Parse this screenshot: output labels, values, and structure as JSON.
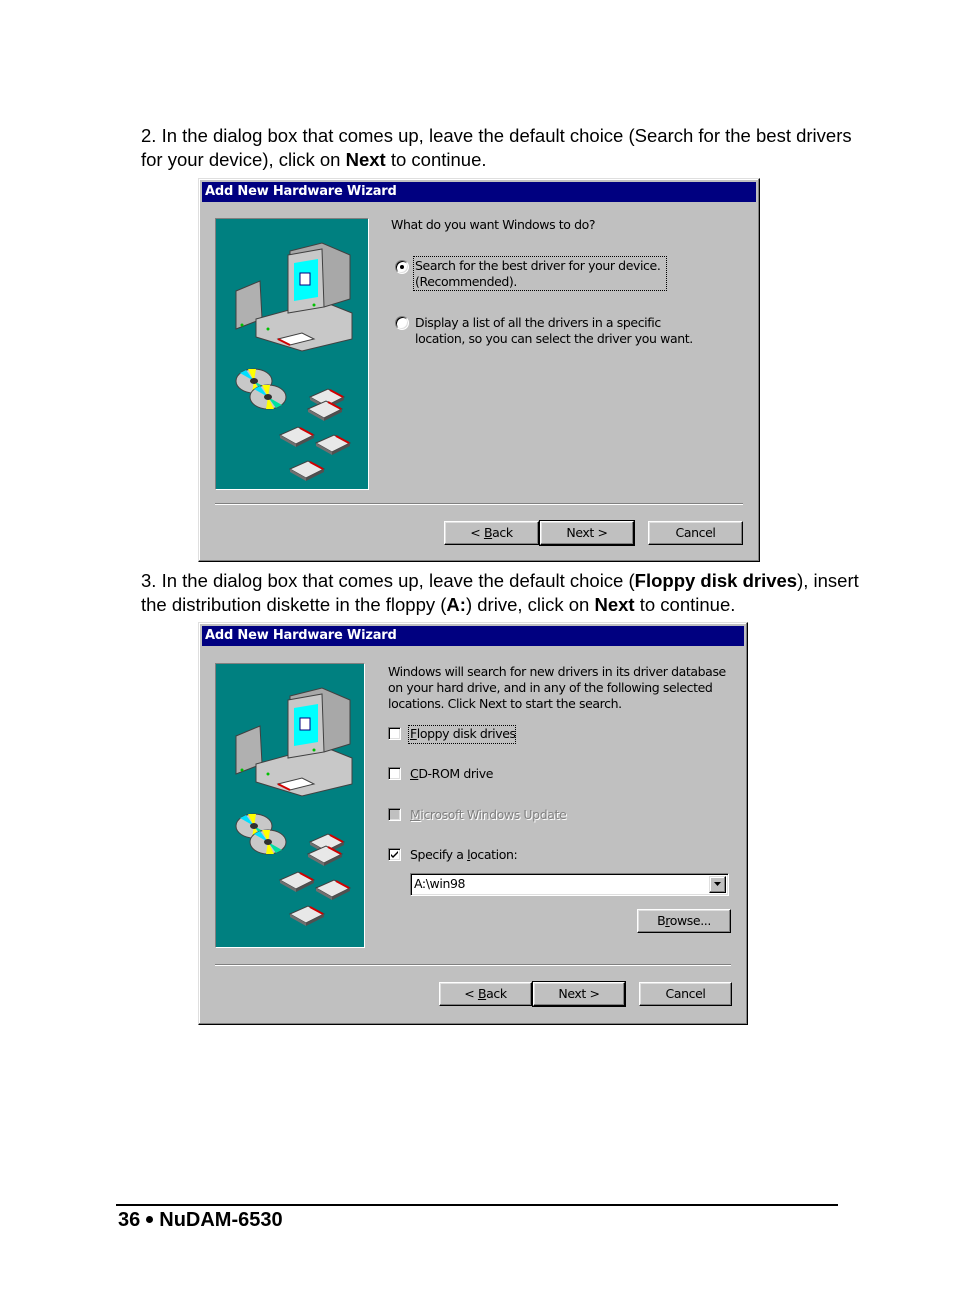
{
  "step2": {
    "text_before": "2. In the dialog box that comes up, leave the default choice (Search for the best drivers for your device), click on ",
    "bold": "Next",
    "text_after": " to continue."
  },
  "dialog1": {
    "title": "Add New Hardware Wizard",
    "prompt": "What do you want Windows to do?",
    "options": [
      {
        "line1": "Search for the best driver for your device.",
        "line2": "(Recommended).",
        "selected": true
      },
      {
        "line1": "Display a list of all the drivers in a specific",
        "line2": "location, so you can select the driver you want.",
        "selected": false
      }
    ],
    "buttons": {
      "back": "< Back",
      "back_mnemonic": "B",
      "next": "Next >",
      "cancel": "Cancel"
    }
  },
  "step3": {
    "t1": "3. In the dialog box that comes up, leave the default choice (",
    "b1": "Floppy disk drives",
    "t2": "), insert the distribution diskette in the floppy (",
    "b2": "A:",
    "t3": ") drive, click on ",
    "b3": "Next",
    "t4": " to continue."
  },
  "dialog2": {
    "title": "Add New Hardware Wizard",
    "description": [
      "Windows will search for new drivers in its driver database",
      "on your hard drive, and in any of the following selected",
      "locations. Click Next to start the search."
    ],
    "checkboxes": [
      {
        "label": "Floppy disk drives",
        "checked": false,
        "enabled": true
      },
      {
        "label": "CD-ROM drive",
        "checked": false,
        "enabled": true
      },
      {
        "label": "Microsoft Windows Update",
        "checked": false,
        "enabled": false
      },
      {
        "label": "Specify a location:",
        "checked": true,
        "enabled": true
      }
    ],
    "location_value": "A:\\win98",
    "browse": "Browse...",
    "buttons": {
      "back": "< Back",
      "next": "Next >",
      "cancel": "Cancel"
    }
  },
  "footer": {
    "page": "36",
    "product": "NuDAM-6530"
  },
  "colors": {
    "titlebar": "#000080",
    "dialog_bg": "#c0c0c0",
    "art_bg": "#008080"
  }
}
